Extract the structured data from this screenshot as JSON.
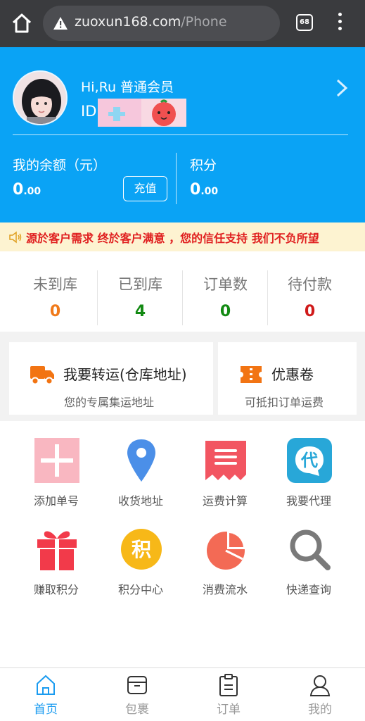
{
  "browser": {
    "url_host": "zuoxun168.com",
    "url_path": "/Phone",
    "tab_count": "68"
  },
  "profile": {
    "greeting": "Hi,Ru 普通会员",
    "id_label": "ID",
    "balance_label": "我的余额（元）",
    "balance_int": "0",
    "balance_dec": ".00",
    "recharge_label": "充值",
    "points_label": "积分",
    "points_int": "0",
    "points_dec": ".00"
  },
  "notice": {
    "text": "源於客户需求 终於客户满意 ，您的信任支持 我们不负所望"
  },
  "stats": [
    {
      "label": "未到库",
      "value": "0",
      "color": "#f07a1a"
    },
    {
      "label": "已到库",
      "value": "4",
      "color": "#138a13"
    },
    {
      "label": "订单数",
      "value": "0",
      "color": "#138a13"
    },
    {
      "label": "待付款",
      "value": "0",
      "color": "#d01a1a"
    }
  ],
  "cards": {
    "transfer": {
      "title": "我要转运(仓库地址)",
      "subtitle": "您的专属集运地址",
      "icon": "truck-icon"
    },
    "coupon": {
      "title": "优惠卷",
      "subtitle": "可抵扣订单运费",
      "icon": "ticket-icon"
    }
  },
  "grid": [
    {
      "label": "添加单号",
      "icon": "plus-icon"
    },
    {
      "label": "收货地址",
      "icon": "location-pin-icon"
    },
    {
      "label": "运费计算",
      "icon": "receipt-icon"
    },
    {
      "label": "我要代理",
      "icon": "agent-icon",
      "glyph": "代"
    },
    {
      "label": "赚取积分",
      "icon": "gift-icon"
    },
    {
      "label": "积分中心",
      "icon": "points-icon",
      "glyph": "积"
    },
    {
      "label": "消费流水",
      "icon": "pie-chart-icon"
    },
    {
      "label": "快递查询",
      "icon": "search-icon"
    }
  ],
  "bottom_nav": [
    {
      "label": "首页",
      "icon": "home-icon",
      "active": true
    },
    {
      "label": "包裹",
      "icon": "package-icon",
      "active": false
    },
    {
      "label": "订单",
      "icon": "clipboard-icon",
      "active": false
    },
    {
      "label": "我的",
      "icon": "user-icon",
      "active": false
    }
  ],
  "colors": {
    "header_blue": "#0aa3f5",
    "notice_bg": "#fdf3d1",
    "notice_text": "#e02020",
    "nav_active": "#1a9bf0"
  }
}
